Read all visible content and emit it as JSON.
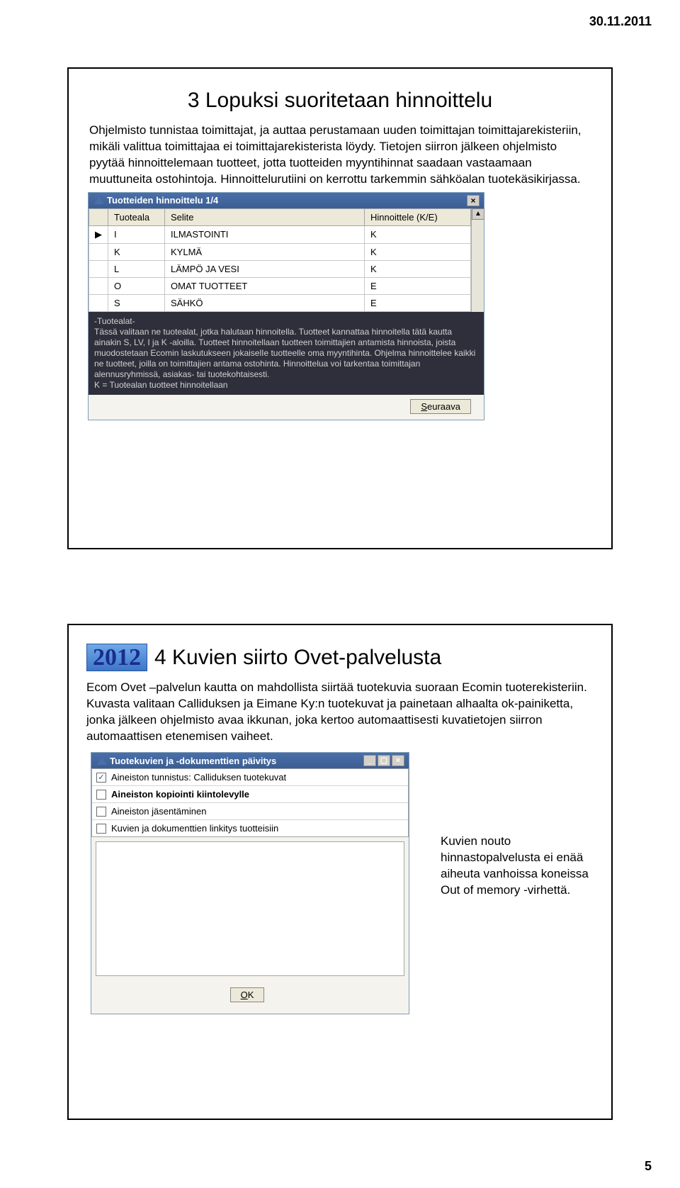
{
  "header_date": "30.11.2011",
  "page_number": "5",
  "slide1": {
    "title": "3 Lopuksi suoritetaan hinnoittelu",
    "para1": "Ohjelmisto tunnistaa toimittajat, ja auttaa perustamaan uuden toimittajan toimittajarekisteriin, mikäli valittua toimittajaa ei toimittajarekisterista löydy. Tietojen siirron jälkeen ohjelmisto pyytää hinnoittelemaan tuotteet, jotta tuotteiden myyntihinnat saadaan vastaamaan muuttuneita ostohintoja. Hinnoittelurutiini on kerrottu tarkemmin sähköalan tuotekäsikirjassa.",
    "dialog": {
      "title": "Tuotteiden hinnoittelu 1/4",
      "cols": [
        "Tuoteala",
        "Selite",
        "Hinnoittele (K/E)"
      ],
      "rows": [
        {
          "a": "I",
          "b": "ILMASTOINTI",
          "c": "K"
        },
        {
          "a": "K",
          "b": "KYLMÄ",
          "c": "K"
        },
        {
          "a": "L",
          "b": "LÄMPÖ JA VESI",
          "c": "K"
        },
        {
          "a": "O",
          "b": "OMAT TUOTTEET",
          "c": "E"
        },
        {
          "a": "S",
          "b": "SÄHKÖ",
          "c": "E"
        }
      ],
      "info_label": "-Tuotealat-",
      "info": "Tässä valitaan ne tuotealat, jotka halutaan hinnoitella. Tuotteet kannattaa hinnoitella tätä kautta ainakin S, LV, I ja K -aloilla. Tuotteet hinnoitellaan tuotteen toimittajien antamista hinnoista, joista muodostetaan Ecomin laskutukseen jokaiselIe tuotteelle oma myyntihinta. Ohjelma hinnoittelee kaikki ne tuotteet, joilla on toimittajien antama ostohinta. Hinnoittelua voi tarkentaa toimittajan alennusryhmissä, asiakas- tai tuotekohtaisesti.",
      "info2": "K = Tuotealan tuotteet hinnoitellaan",
      "next_btn": "Seuraava"
    }
  },
  "slide2": {
    "badge": "2012",
    "title": "4  Kuvien siirto Ovet-palvelusta",
    "para": "Ecom Ovet –palvelun kautta on mahdollista siirtää tuotekuvia suoraan Ecomin tuoterekisteriin. Kuvasta valitaan Calliduksen ja Eimane Ky:n  tuotekuvat ja painetaan alhaalta ok-painiketta, jonka jälkeen ohjelmisto avaa ikkunan, joka kertoo automaattisesti kuvatietojen siirron automaattisen etenemisen vaiheet.",
    "side": "Kuvien nouto hinnastopalvelusta ei enää aiheuta vanhoissa koneissa Out of memory -virhettä.",
    "dialog": {
      "title": "Tuotekuvien ja -dokumenttien päivitys",
      "items": [
        {
          "checked": true,
          "bold": false,
          "label": "Aineiston tunnistus: Calliduksen tuotekuvat"
        },
        {
          "checked": false,
          "bold": true,
          "label": "Aineiston kopiointi kiintolevylle"
        },
        {
          "checked": false,
          "bold": false,
          "label": "Aineiston jäsentäminen"
        },
        {
          "checked": false,
          "bold": false,
          "label": "Kuvien ja dokumenttien linkitys tuotteisiin"
        }
      ],
      "ok_btn": "OK"
    }
  }
}
